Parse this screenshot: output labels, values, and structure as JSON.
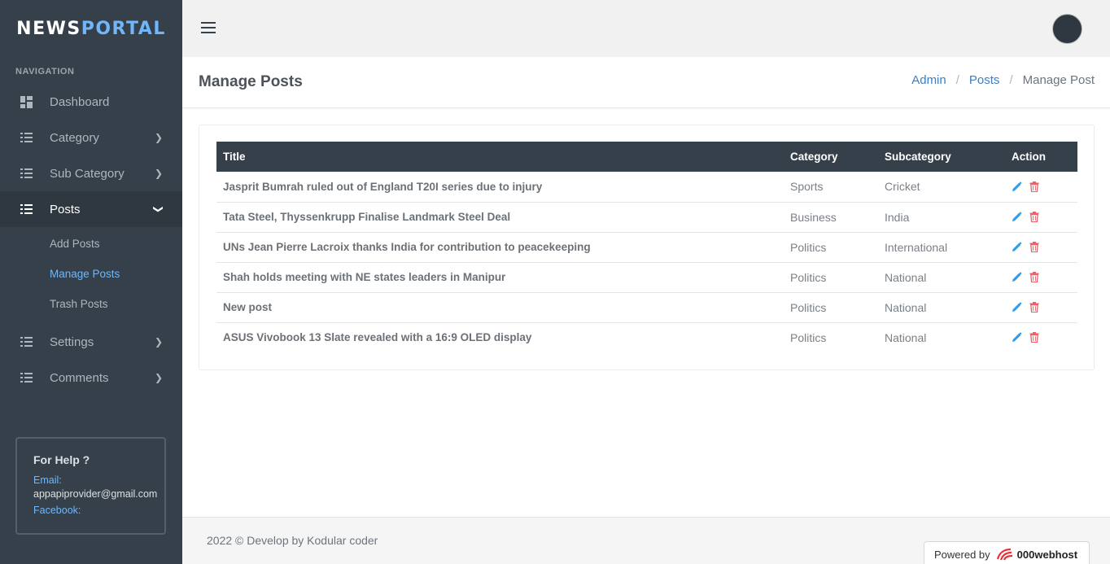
{
  "brand": {
    "part1": "NEWS",
    "part2": "PORTAL"
  },
  "navigation": {
    "title": "NAVIGATION",
    "items": [
      {
        "label": "Dashboard",
        "icon": "dashboard-icon"
      },
      {
        "label": "Category",
        "icon": "list-icon"
      },
      {
        "label": "Sub Category",
        "icon": "list-icon"
      },
      {
        "label": "Posts",
        "icon": "list-icon"
      },
      {
        "label": "Settings",
        "icon": "list-icon"
      },
      {
        "label": "Comments",
        "icon": "list-icon"
      }
    ],
    "posts_sub": [
      "Add Posts",
      "Manage Posts",
      "Trash Posts"
    ]
  },
  "help": {
    "title": "For Help ?",
    "email_label": "Email:",
    "email_value": "appapiprovider@gmail.com",
    "facebook_label": "Facebook:"
  },
  "page": {
    "title": "Manage Posts",
    "breadcrumb": [
      "Admin",
      "Posts",
      "Manage Post"
    ]
  },
  "table": {
    "headers": [
      "Title",
      "Category",
      "Subcategory",
      "Action"
    ],
    "rows": [
      {
        "title": "Jasprit Bumrah ruled out of England T20I series due to injury",
        "category": "Sports",
        "subcategory": "Cricket"
      },
      {
        "title": "Tata Steel, Thyssenkrupp Finalise Landmark Steel Deal",
        "category": "Business",
        "subcategory": "India"
      },
      {
        "title": "UNs Jean Pierre Lacroix thanks India for contribution to peacekeeping",
        "category": "Politics",
        "subcategory": "International"
      },
      {
        "title": "Shah holds meeting with NE states leaders in Manipur",
        "category": "Politics",
        "subcategory": "National"
      },
      {
        "title": "New post",
        "category": "Politics",
        "subcategory": "National"
      },
      {
        "title": "ASUS Vivobook 13 Slate revealed with a 16:9 OLED display",
        "category": "Politics",
        "subcategory": "National"
      }
    ]
  },
  "footer": {
    "text": "2022 © Develop by Kodular coder",
    "powered_by": "Powered by",
    "host": "000webhost"
  },
  "colors": {
    "sidebar": "#36404a",
    "accent": "#71b6f9",
    "edit": "#2f9ee8",
    "delete": "#e8626a"
  }
}
